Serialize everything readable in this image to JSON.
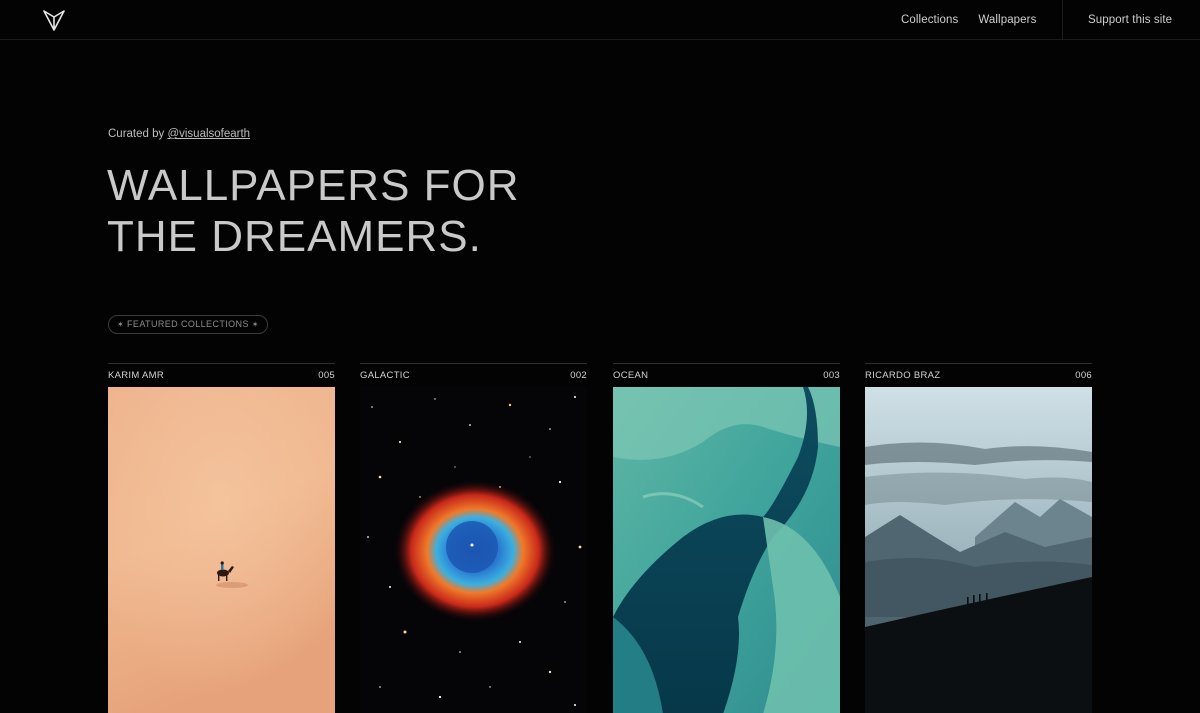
{
  "nav": {
    "logo": "v-logo-icon",
    "links": [
      "Collections",
      "Wallpapers"
    ],
    "support": "Support this site"
  },
  "hero": {
    "curated_prefix": "Curated by ",
    "curated_handle": "@visualsofearth",
    "title_line1": "WALLPAPERS FOR",
    "title_line2": "THE DREAMERS."
  },
  "badge": {
    "star": "✶",
    "label": "FEATURED COLLECTIONS"
  },
  "collections": [
    {
      "name": "KARIM AMR",
      "count": "005",
      "image": "desert-camel-image"
    },
    {
      "name": "GALACTIC",
      "count": "002",
      "image": "helix-nebula-image"
    },
    {
      "name": "OCEAN",
      "count": "003",
      "image": "aerial-ocean-image"
    },
    {
      "name": "RICARDO BRAZ",
      "count": "006",
      "image": "misty-mountains-image"
    }
  ],
  "colors": {
    "background": "#030303",
    "text": "#c9c9c9"
  }
}
